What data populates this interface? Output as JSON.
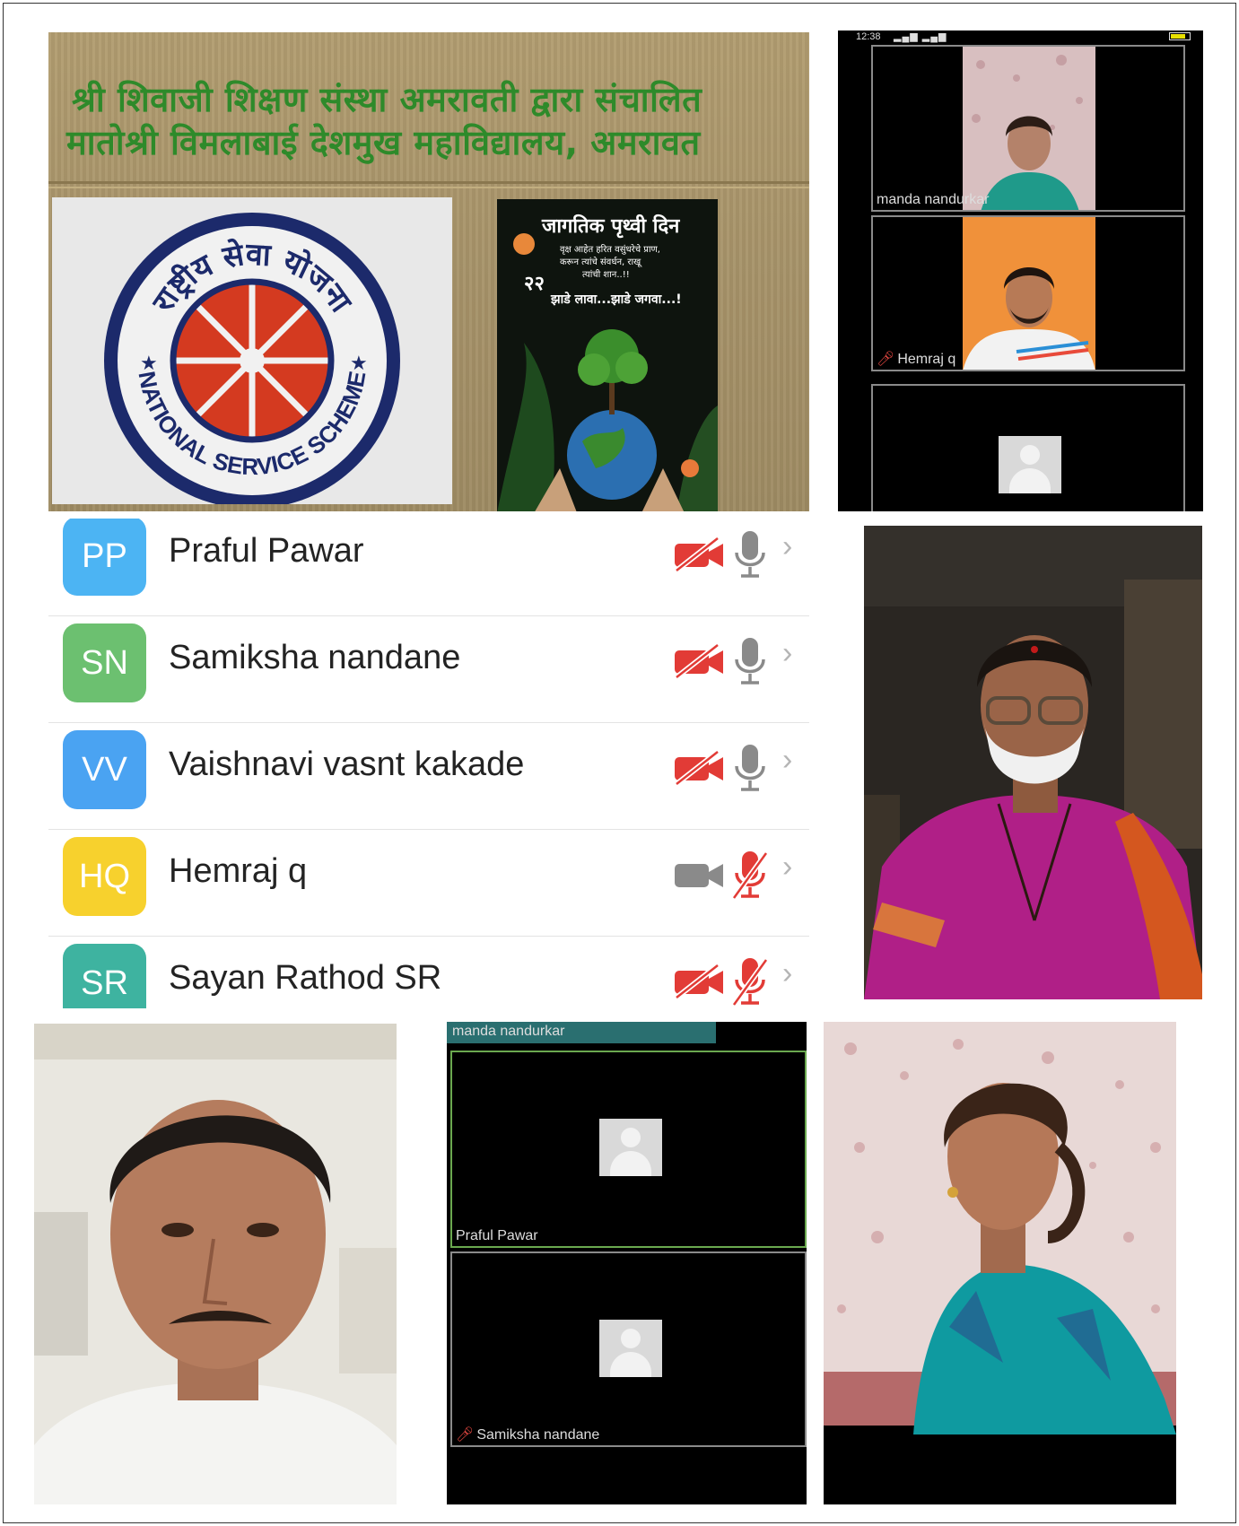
{
  "banner": {
    "line1": "श्री शिवाजी शिक्षण संस्था अमरावती द्वारा संचालित",
    "line2": "मातोश्री विमलाबाई देशमुख महाविद्यालय, अमरावत",
    "logo": {
      "top_text": "राष्ट्रीय सेवा योजना",
      "bottom_text": "NATIONAL SERVICE SCHEME"
    },
    "poster": {
      "title": "जागतिक पृथ्वी दिन",
      "line1": "वृक्ष आहेत हरित वसुंधरेचे प्राण,",
      "line2": "करून त्यांचे संवर्धन, राखू",
      "line3": "त्यांची शान..!!",
      "number": "२२",
      "slogan": "झाडे लावा...झाडे जगवा...!"
    }
  },
  "zoom_top": {
    "status_time": "12:38",
    "tiles": [
      {
        "name": "manda nandurkar",
        "muted": false
      },
      {
        "name": "Hemraj q",
        "muted": true
      },
      {
        "name": "",
        "muted": false
      }
    ]
  },
  "participants": [
    {
      "initials": "PP",
      "name": "Praful Pawar",
      "color": "#4cb4f3",
      "video_off": true,
      "mic_muted": false
    },
    {
      "initials": "SN",
      "name": "Samiksha nandane",
      "color": "#6cc070",
      "video_off": true,
      "mic_muted": false
    },
    {
      "initials": "VV",
      "name": "Vaishnavi vasnt kakade",
      "color": "#4aa3f2",
      "video_off": true,
      "mic_muted": false
    },
    {
      "initials": "HQ",
      "name": "Hemraj q",
      "color": "#f7d12d",
      "video_off": false,
      "mic_muted": true
    },
    {
      "initials": "SR",
      "name": "Sayan Rathod SR",
      "color": "#3eb3a0",
      "video_off": true,
      "mic_muted": true
    }
  ],
  "zoom_bottom": {
    "top_label": "manda nandurkar",
    "tiles": [
      {
        "name": "Praful Pawar",
        "muted": false
      },
      {
        "name": "Samiksha nandane",
        "muted": true
      }
    ]
  },
  "colors": {
    "banner_text": "#2e8a2a",
    "nss_blue": "#1c2a6b",
    "nss_red": "#d43a20",
    "muted_red": "#e23b36",
    "icon_gray": "#8a8a8a"
  }
}
